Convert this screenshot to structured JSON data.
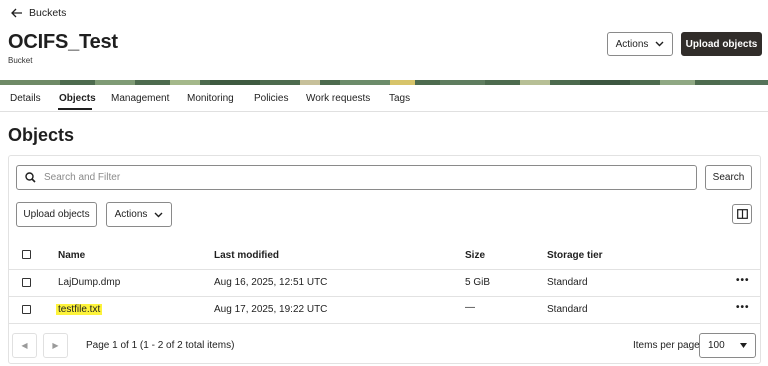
{
  "header": {
    "back_label": "Buckets",
    "bucket_name": "OCIFS_Test",
    "bucket_subtitle": "Bucket",
    "actions_label": "Actions",
    "upload_label": "Upload objects"
  },
  "tabs": [
    {
      "label": "Details"
    },
    {
      "label": "Objects",
      "active": true
    },
    {
      "label": "Management"
    },
    {
      "label": "Monitoring"
    },
    {
      "label": "Policies"
    },
    {
      "label": "Work requests"
    },
    {
      "label": "Tags"
    }
  ],
  "section_title": "Objects",
  "search": {
    "placeholder": "Search and Filter",
    "button_label": "Search"
  },
  "toolbar": {
    "upload_label": "Upload objects",
    "actions_label": "Actions",
    "columns_icon": "columns-icon"
  },
  "table": {
    "headers": [
      "Name",
      "Last modified",
      "Size",
      "Storage tier"
    ],
    "rows": [
      {
        "name": "LajDump.dmp",
        "modified": "Aug 16, 2025, 12:51 UTC",
        "size": "5 GiB",
        "tier": "Standard",
        "highlighted": false
      },
      {
        "name": "testfile.txt",
        "modified": "Aug 17, 2025, 19:22 UTC",
        "size": "—",
        "tier": "Standard",
        "highlighted": true
      }
    ]
  },
  "pagination": {
    "summary": "Page 1 of 1 (1 - 2 of 2 total items)",
    "items_per_page_label": "Items per page",
    "items_per_page_value": "100"
  },
  "colors": {
    "dark_button": "#312d2a",
    "highlight": "#fdf33b",
    "border": "#8a8a8a",
    "divider": "#e2e2e2"
  }
}
